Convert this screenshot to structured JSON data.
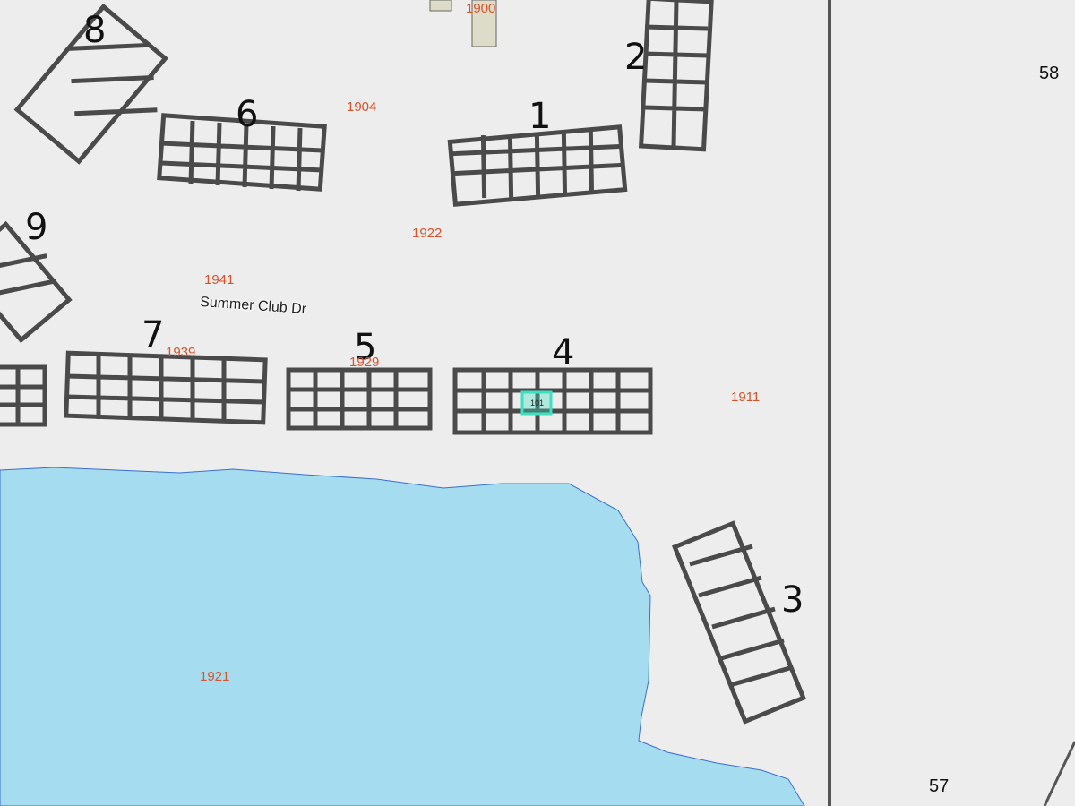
{
  "map": {
    "street_label": "Summer Club Dr",
    "section_labels": [
      "58",
      "57"
    ],
    "building_numbers": [
      "1",
      "2",
      "3",
      "4",
      "5",
      "6",
      "7",
      "8",
      "9"
    ],
    "parcel_labels": {
      "p1900": "1900",
      "p1904": "1904",
      "p1922": "1922",
      "p1941": "1941",
      "p1911": "1911",
      "p1921": "1921",
      "p1939": "1939",
      "p1929": "1929"
    },
    "selected_unit": "101",
    "colors": {
      "background": "#ededed",
      "water": "#a6dcf0",
      "shoreline": "#3a6fd0",
      "building_outline": "#4a4a4a",
      "parcel_text": "#d9532a",
      "selection": "#3fe0c0"
    }
  }
}
